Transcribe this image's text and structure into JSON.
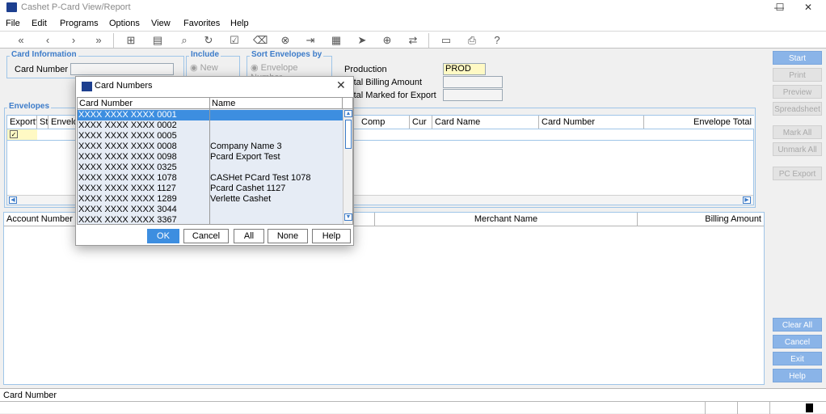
{
  "window": {
    "title": "Cashet P-Card View/Report",
    "minimize": "—",
    "maximize": "☐",
    "close": "✕"
  },
  "menu": [
    "File",
    "Edit",
    "Programs",
    "Options",
    "View",
    "Favorites",
    "Help"
  ],
  "card_info": {
    "legend": "Card Information",
    "card_number_label": "Card Number",
    "card_number_value": ""
  },
  "include": {
    "legend": "Include",
    "option": "New"
  },
  "sort": {
    "legend": "Sort Envelopes by",
    "option": "Envelope Number"
  },
  "production": {
    "label": "Production",
    "value": "PROD",
    "total_billing_label": "Total Billing Amount",
    "total_billing_value": "",
    "total_marked_label": "Total Marked for Export",
    "total_marked_value": ""
  },
  "envelopes": {
    "legend": "Envelopes",
    "columns": [
      "Export?",
      "St",
      "Envelop",
      "Comp",
      "Cur",
      "Card Name",
      "Card Number",
      "Envelope Total"
    ]
  },
  "transactions": {
    "columns": [
      "Account Number",
      "Merchant Name",
      "Billing Amount"
    ]
  },
  "side_buttons": {
    "start": "Start",
    "print": "Print",
    "preview": "Preview",
    "spreadsheet": "Spreadsheet",
    "mark_all": "Mark All",
    "unmark_all": "Unmark All",
    "pc_export": "PC Export",
    "clear_all": "Clear All",
    "cancel": "Cancel",
    "exit": "Exit",
    "help": "Help"
  },
  "status": {
    "label": "Card Number"
  },
  "dialog": {
    "title": "Card Numbers",
    "close": "✕",
    "columns": {
      "card_number": "Card Number",
      "name": "Name"
    },
    "rows": [
      {
        "card_number": "XXXX XXXX XXXX 0001",
        "name": ""
      },
      {
        "card_number": "XXXX XXXX XXXX 0002",
        "name": ""
      },
      {
        "card_number": "XXXX XXXX XXXX 0005",
        "name": ""
      },
      {
        "card_number": "XXXX XXXX XXXX 0008",
        "name": "Company Name 3"
      },
      {
        "card_number": "XXXX XXXX XXXX 0098",
        "name": "Pcard Export Test"
      },
      {
        "card_number": "XXXX XXXX XXXX 0325",
        "name": ""
      },
      {
        "card_number": "XXXX XXXX XXXX 1078",
        "name": "CASHet PCard Test 1078"
      },
      {
        "card_number": "XXXX XXXX XXXX 1127",
        "name": "Pcard Cashet 1127"
      },
      {
        "card_number": "XXXX XXXX XXXX 1289",
        "name": "Verlette Cashet"
      },
      {
        "card_number": "XXXX XXXX XXXX 3044",
        "name": ""
      },
      {
        "card_number": "XXXX XXXX XXXX 3367",
        "name": ""
      }
    ],
    "selected_index": 0,
    "buttons": {
      "ok": "OK",
      "cancel": "Cancel",
      "all": "All",
      "none": "None",
      "help": "Help"
    }
  },
  "colors": {
    "accent": "#3d8ee0",
    "legend": "#3d7cc9",
    "prod_field": "#fff9c4"
  }
}
